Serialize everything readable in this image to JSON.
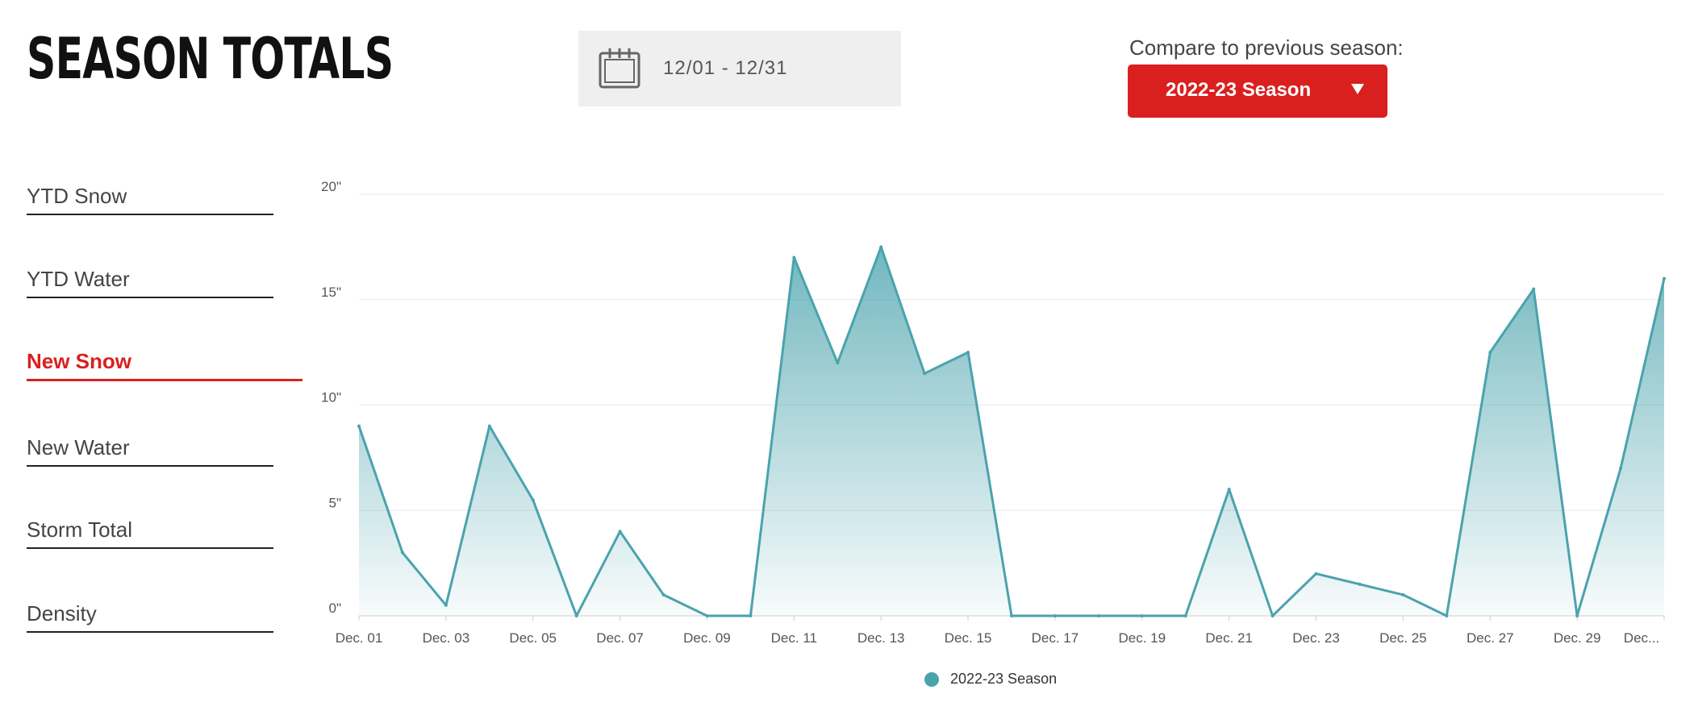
{
  "header": {
    "title": "SEASON TOTALS",
    "date_range": "12/01 - 12/31",
    "compare_label": "Compare to previous season:",
    "season_button": "2022-23 Season"
  },
  "metrics": [
    {
      "label": "YTD Snow",
      "active": false
    },
    {
      "label": "YTD Water",
      "active": false
    },
    {
      "label": "New Snow",
      "active": true
    },
    {
      "label": "New Water",
      "active": false
    },
    {
      "label": "Storm Total",
      "active": false
    },
    {
      "label": "Density",
      "active": false
    }
  ],
  "colors": {
    "accent": "#d9201f",
    "series": "#4aa3ad"
  },
  "icons": {
    "date": "calendar-icon",
    "dropdown": "caret-down-icon"
  },
  "chart_data": {
    "type": "area",
    "title": "",
    "xlabel": "",
    "ylabel": "",
    "ylim": [
      0,
      20
    ],
    "y_ticks": [
      "0\"",
      "5\"",
      "10\"",
      "15\"",
      "20\""
    ],
    "x_tick_labels": [
      "Dec. 01",
      "Dec. 03",
      "Dec. 05",
      "Dec. 07",
      "Dec. 09",
      "Dec. 11",
      "Dec. 13",
      "Dec. 15",
      "Dec. 17",
      "Dec. 19",
      "Dec. 21",
      "Dec. 23",
      "Dec. 25",
      "Dec. 27",
      "Dec. 29",
      "Dec..."
    ],
    "x": [
      1,
      2,
      3,
      4,
      5,
      6,
      7,
      8,
      9,
      10,
      11,
      12,
      13,
      14,
      15,
      16,
      17,
      18,
      19,
      20,
      21,
      22,
      23,
      24,
      25,
      26,
      27,
      28,
      29,
      30,
      31
    ],
    "series": [
      {
        "name": "2022-23 Season",
        "values": [
          9,
          3,
          0.5,
          9,
          5.5,
          0,
          4,
          1,
          0,
          0,
          17,
          12,
          17.5,
          11.5,
          12.5,
          0,
          0,
          0,
          0,
          0,
          6,
          0,
          2,
          1.5,
          1,
          0,
          12.5,
          15.5,
          0,
          7,
          16
        ]
      }
    ],
    "grid": true,
    "legend_position": "bottom-center"
  }
}
